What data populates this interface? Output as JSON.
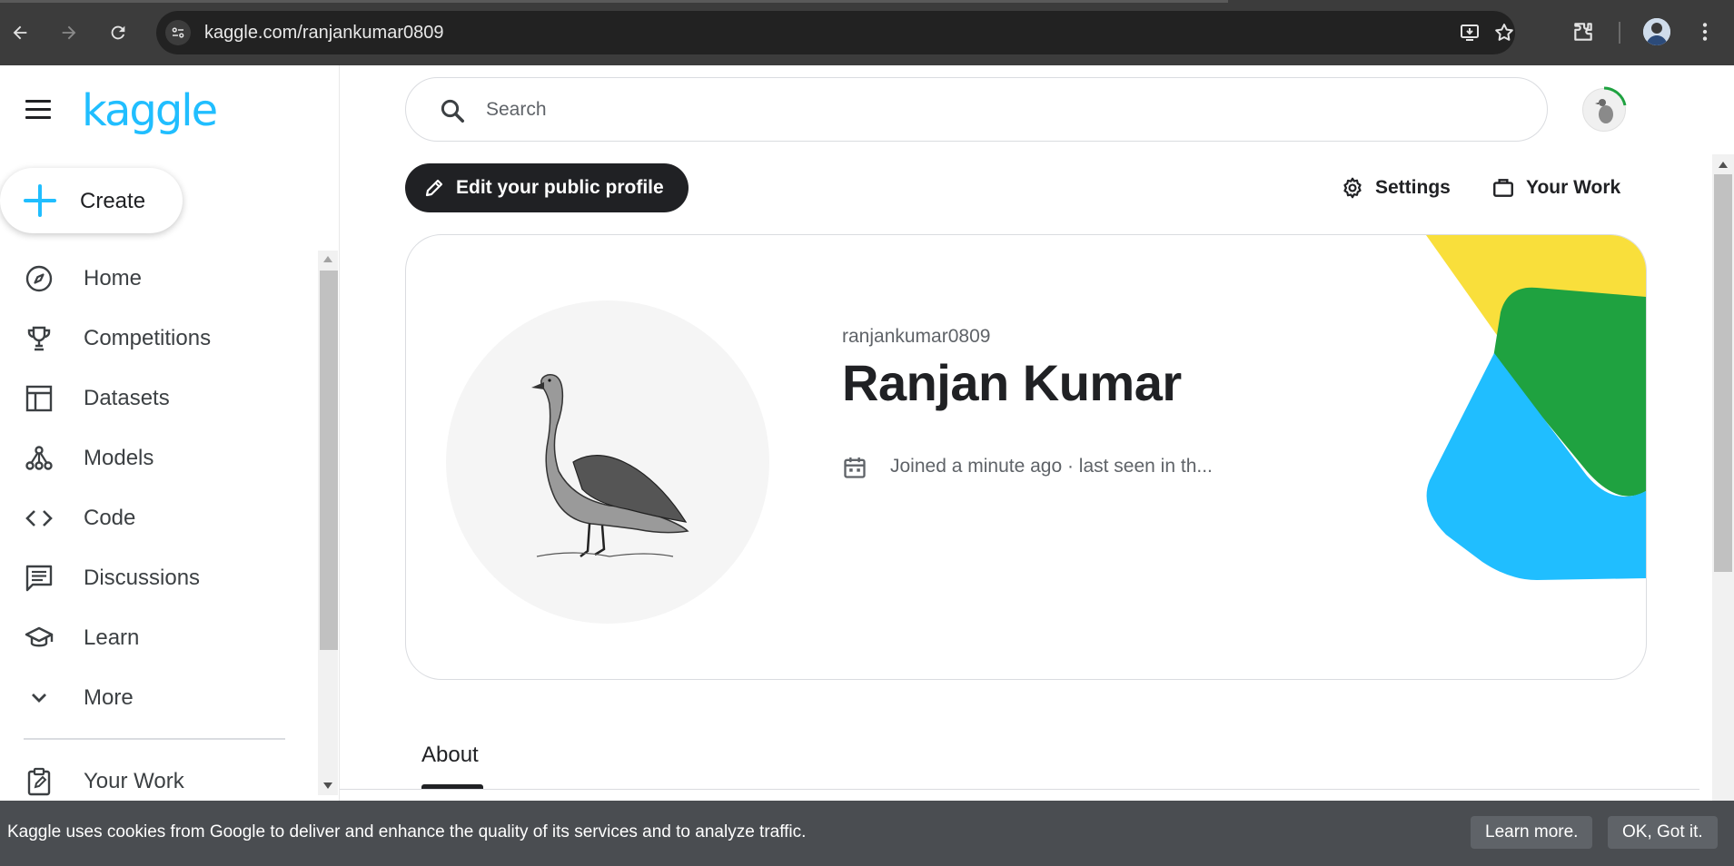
{
  "browser": {
    "url": "kaggle.com/ranjankumar0809"
  },
  "sidebar": {
    "logo": "kaggle",
    "create_label": "Create",
    "items": [
      {
        "label": "Home",
        "icon": "compass-icon"
      },
      {
        "label": "Competitions",
        "icon": "trophy-icon"
      },
      {
        "label": "Datasets",
        "icon": "table-icon"
      },
      {
        "label": "Models",
        "icon": "models-icon"
      },
      {
        "label": "Code",
        "icon": "code-icon"
      },
      {
        "label": "Discussions",
        "icon": "discussion-icon"
      },
      {
        "label": "Learn",
        "icon": "school-icon"
      },
      {
        "label": "More",
        "icon": "chevron-down-icon"
      },
      {
        "label": "Your Work",
        "icon": "clipboard-icon"
      }
    ]
  },
  "search": {
    "placeholder": "Search"
  },
  "profile_actions": {
    "edit_label": "Edit your public profile",
    "settings_label": "Settings",
    "your_work_label": "Your Work"
  },
  "profile": {
    "username": "ranjankumar0809",
    "name": "Ranjan Kumar",
    "joined": "Joined a minute ago · last seen in th..."
  },
  "tabs": {
    "about": "About"
  },
  "cookie_banner": {
    "text": "Kaggle uses cookies from Google to deliver and enhance the quality of its services and to analyze traffic.",
    "learn_more": "Learn more.",
    "ok": "OK, Got it."
  },
  "colors": {
    "brand": "#20beff",
    "yellow": "#f9df3b",
    "green": "#1fa240",
    "blue": "#20beff"
  }
}
